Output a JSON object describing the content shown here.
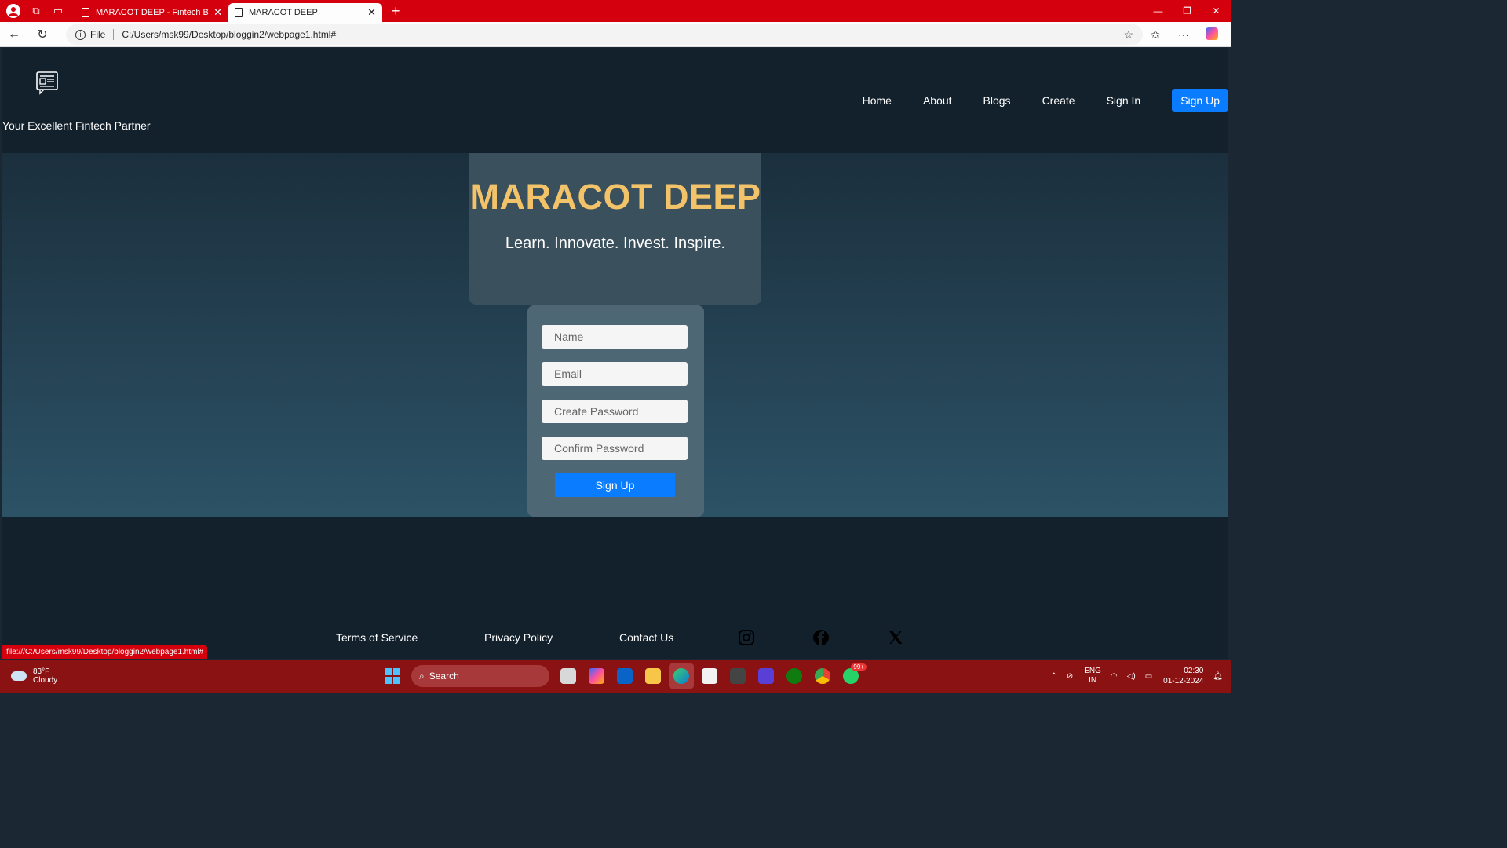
{
  "browser": {
    "tabs": [
      {
        "title": "MARACOT DEEP - Fintech Bloggin",
        "active": false
      },
      {
        "title": "MARACOT DEEP",
        "active": true
      }
    ],
    "address": {
      "scheme_label": "File",
      "url": "C:/Users/msk99/Desktop/bloggin2/webpage1.html#"
    },
    "status_url": "file:///C:/Users/msk99/Desktop/bloggin2/webpage1.html#"
  },
  "site": {
    "tagline": "Your Excellent Fintech Partner",
    "nav": [
      "Home",
      "About",
      "Blogs",
      "Create",
      "Sign In",
      "Sign Up"
    ],
    "hero": {
      "title": "MARACOT DEEP",
      "subtitle": "Learn. Innovate. Invest. Inspire."
    },
    "form": {
      "name_placeholder": "Name",
      "email_placeholder": "Email",
      "password_placeholder": "Create Password",
      "confirm_placeholder": "Confirm Password",
      "submit_label": "Sign Up"
    },
    "footer": {
      "links": [
        "Terms of Service",
        "Privacy Policy",
        "Contact Us"
      ],
      "social_icons": [
        "instagram-icon",
        "facebook-icon",
        "x-icon"
      ]
    },
    "colors": {
      "accent": "#0a7cff",
      "title": "#f3c36a",
      "header_bg": "#13212c"
    }
  },
  "taskbar": {
    "weather": {
      "temp": "83°F",
      "condition": "Cloudy"
    },
    "search_label": "Search",
    "badge": "99+",
    "language": {
      "line1": "ENG",
      "line2": "IN"
    },
    "clock": {
      "time": "02:30",
      "date": "01-12-2024"
    }
  }
}
